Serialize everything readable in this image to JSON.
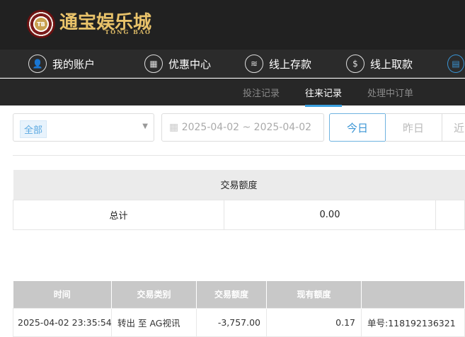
{
  "header": {
    "logo_text": "通宝娱乐城",
    "logo_en": "TONG BAO",
    "logo_chip": "TB"
  },
  "nav": [
    {
      "label": "我的账户",
      "icon": "user-icon"
    },
    {
      "label": "优惠中心",
      "icon": "gift-icon"
    },
    {
      "label": "线上存款",
      "icon": "deposit-icon"
    },
    {
      "label": "线上取款",
      "icon": "withdraw-icon"
    },
    {
      "label": "",
      "icon": "records-icon"
    }
  ],
  "subnav": [
    {
      "label": "投注记录"
    },
    {
      "label": "往来记录",
      "active": true
    },
    {
      "label": "处理中订单"
    }
  ],
  "filters": {
    "type_selected": "全部",
    "date_range": "2025-04-02 ~ 2025-04-02",
    "quick": [
      "今日",
      "昨日",
      "近"
    ]
  },
  "summary": {
    "header": "交易额度",
    "row_label": "总计",
    "value": "0.00"
  },
  "detail": {
    "columns": [
      "时间",
      "交易类别",
      "交易额度",
      "现有额度",
      ""
    ],
    "rows": [
      [
        "2025-04-02 23:35:54",
        "转出 至 AG视讯",
        "-3,757.00",
        "0.17",
        "单号:118192136321"
      ]
    ]
  },
  "colors": {
    "accent": "#3a95d5",
    "header_bg": "#212121"
  }
}
